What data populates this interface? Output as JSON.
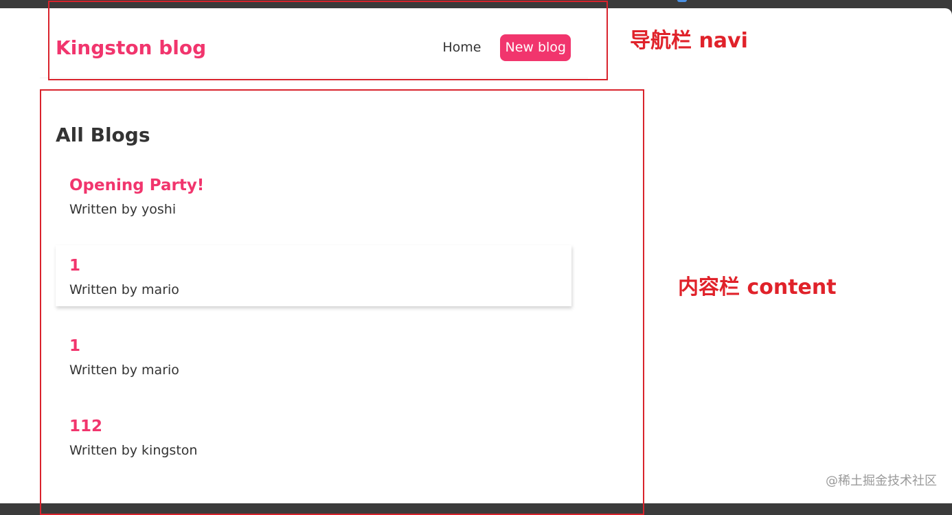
{
  "navbar": {
    "brand": "Kingston blog",
    "links": [
      {
        "label": "Home"
      },
      {
        "label": "New blog"
      }
    ]
  },
  "content": {
    "title": "All Blogs",
    "blogs": [
      {
        "title": "Opening Party!",
        "author": "Written by yoshi"
      },
      {
        "title": "1",
        "author": "Written by mario"
      },
      {
        "title": "1",
        "author": "Written by mario"
      },
      {
        "title": "112",
        "author": "Written by kingston"
      }
    ]
  },
  "annotations": {
    "navi": "导航栏 navi",
    "content": "内容栏 content"
  },
  "watermark": "@稀土掘金技术社区",
  "colors": {
    "accent": "#f1356d",
    "annotation": "#e0222a",
    "text": "#333333"
  }
}
